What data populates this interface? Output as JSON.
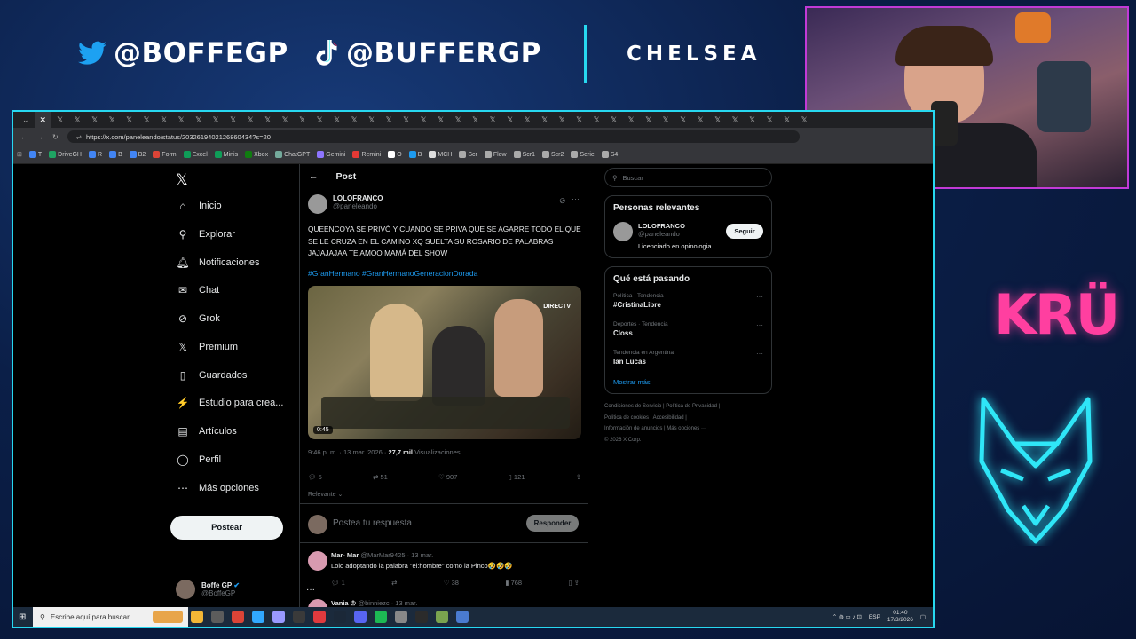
{
  "overlay": {
    "twitter_handle": "@BOFFEGP",
    "tiktok_handle": "@BUFFERGP",
    "sponsor": "CHELSEA"
  },
  "browser": {
    "tab_count": 44,
    "url": "https://x.com/paneleando/status/2032619402126860434?s=20",
    "bookmarks": [
      "T",
      "DriveGH",
      "R",
      "B",
      "B2",
      "Form",
      "Excel",
      "Minis",
      "Xbox",
      "ChatGPT",
      "Gemini",
      "Remini",
      "O",
      "B",
      "MCH",
      "Scr",
      "Flow",
      "Scr1",
      "Scr2",
      "Serie",
      "S4"
    ]
  },
  "nav": {
    "items": [
      "Inicio",
      "Explorar",
      "Notificaciones",
      "Chat",
      "Grok",
      "Premium",
      "Guardados",
      "Estudio para crea...",
      "Artículos",
      "Perfil",
      "Más opciones"
    ],
    "post_label": "Postear",
    "user_name": "Boffe GP",
    "user_handle": "@BoffeGP"
  },
  "post": {
    "header": "Post",
    "author_name": "LOLOFRANCO",
    "author_handle": "@paneleando",
    "text": "QUEENCOYA SE PRIVÓ Y CUANDO SE PRIVA QUE SE AGARRE TODO EL QUE SE LE CRUZA EN EL CAMINO XQ SUELTA SU ROSARIO DE PALABRAS JAJAJAJAA TE AMOO MAMÁ DEL SHOW",
    "hashtags": "#GranHermano #GranHermanoGeneracionDorada",
    "video_time": "0:45",
    "channel": "DIRECTV",
    "timestamp": "9:46 p. m. · 13 mar. 2026 · ",
    "views": "27,7 mil",
    "views_label": " Visualizaciones",
    "replies": "5",
    "reposts": "51",
    "likes": "907",
    "bookmarks": "121",
    "sort_label": "Relevante",
    "reply_placeholder": "Postea tu respuesta",
    "reply_button": "Responder"
  },
  "replies": [
    {
      "name": "Mar- Mar",
      "handle": "@MarMar9425 · 13 mar.",
      "text": "Lolo adoptando la palabra \"el:hombre\" como la Pinco🤣🤣🤣",
      "replies": "1",
      "likes": "38",
      "views": "768"
    },
    {
      "name": "Vania ♔",
      "handle": "@binniezc · 13 mar."
    }
  ],
  "sidebar": {
    "search_placeholder": "Buscar",
    "relevant_title": "Personas relevantes",
    "relevant_name": "LOLOFRANCO",
    "relevant_handle": "@paneleando",
    "relevant_bio": "Licenciado en opinologia",
    "follow_label": "Seguir",
    "trends_title": "Qué está pasando",
    "trends": [
      {
        "category": "Política · Tendencia",
        "name": "#CristinaLibre"
      },
      {
        "category": "Deportes · Tendencia",
        "name": "Closs"
      },
      {
        "category": "Tendencia en Argentina",
        "name": "Ian Lucas"
      }
    ],
    "show_more": "Mostrar más",
    "footer_line1": "Condiciones de Servicio  |  Política de Privacidad  |",
    "footer_line2": "Política de cookies  |  Accesibilidad  |",
    "footer_line3": "Información de anuncios  |  Más opciones ···",
    "footer_line4": "© 2026 X Corp."
  },
  "taskbar": {
    "search_placeholder": "Escribe aquí para buscar.",
    "language": "ESP",
    "time": "01:40",
    "date": "17/3/2026"
  },
  "colors": {
    "accent_blue": "#1d9bf0",
    "frame_cyan": "#27d8f0",
    "webcam_border": "#c23ad6",
    "kru_pink": "#ff3fa0"
  }
}
